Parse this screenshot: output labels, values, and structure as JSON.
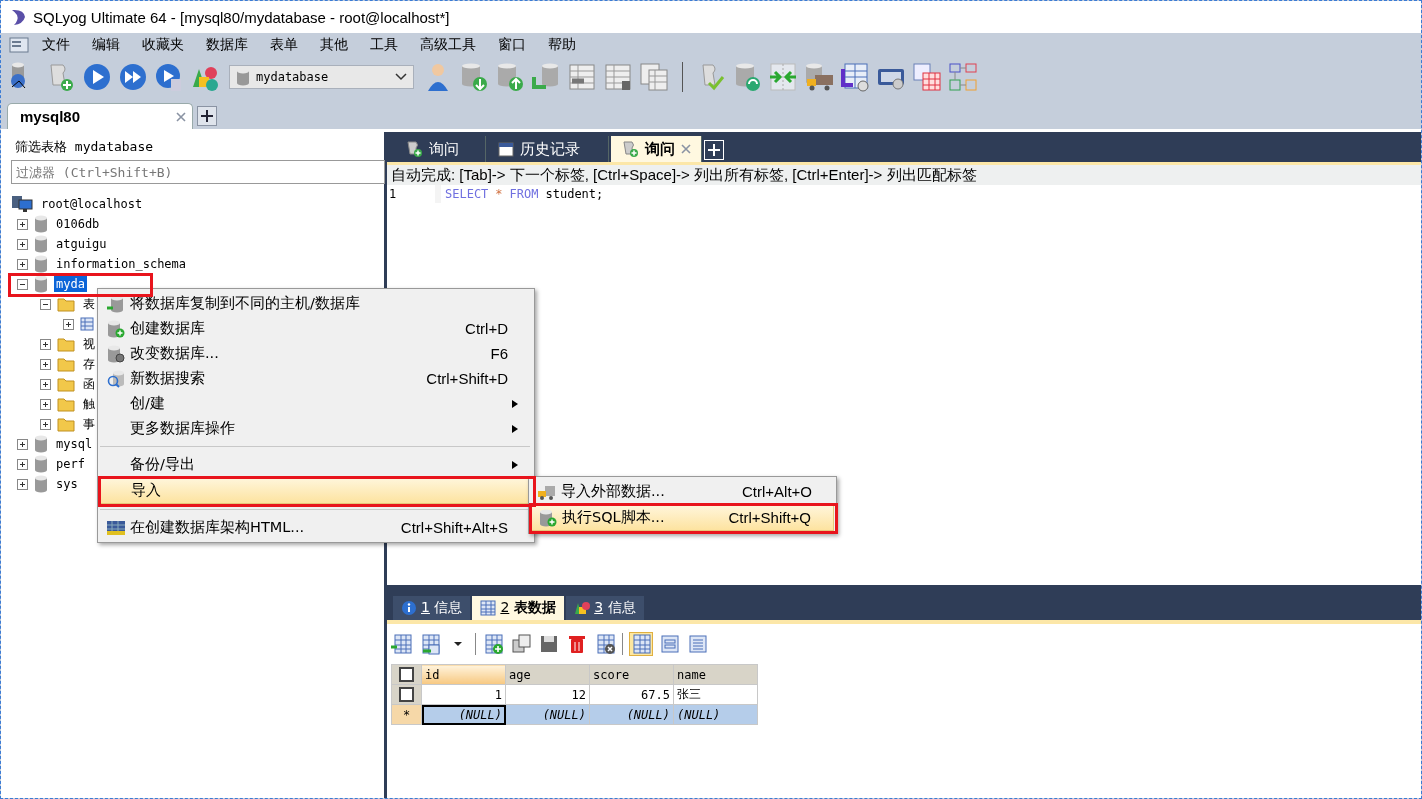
{
  "window": {
    "title": "SQLyog Ultimate 64 - [mysql80/mydatabase - root@localhost*]"
  },
  "menu": [
    "文件",
    "编辑",
    "收藏夹",
    "数据库",
    "表单",
    "其他",
    "工具",
    "高级工具",
    "窗口",
    "帮助"
  ],
  "toolbar": {
    "database_select": "mydatabase"
  },
  "connection_tabs": [
    {
      "label": "mysql80",
      "selected": true
    }
  ],
  "filter": {
    "title": "筛选表格 mydatabase",
    "placeholder": "过滤器 (Ctrl+Shift+B)"
  },
  "tree": {
    "root": "root@localhost",
    "children": [
      {
        "label": "0106db",
        "expanded": false,
        "selected": false,
        "highlighted": false
      },
      {
        "label": "atguigu",
        "expanded": false,
        "selected": false,
        "highlighted": false
      },
      {
        "label": "information_schema",
        "expanded": false,
        "selected": false,
        "highlighted": false
      },
      {
        "label": "myda",
        "expanded": true,
        "selected": true,
        "highlighted": true,
        "children": [
          {
            "label": "表",
            "kind": "folder",
            "expanded": true,
            "children": [
              {
                "kind": "table",
                "expanded": false
              }
            ]
          },
          {
            "label": "视",
            "kind": "folder",
            "expanded": false
          },
          {
            "label": "存",
            "kind": "folder",
            "expanded": false
          },
          {
            "label": "函",
            "kind": "folder",
            "expanded": false
          },
          {
            "label": "触",
            "kind": "folder",
            "expanded": false
          },
          {
            "label": "事",
            "kind": "folder",
            "expanded": false
          }
        ]
      },
      {
        "label": "mysql",
        "expanded": false,
        "selected": false,
        "highlighted": false
      },
      {
        "label": "perf",
        "expanded": false,
        "selected": false,
        "highlighted": false
      },
      {
        "label": "sys",
        "expanded": false,
        "selected": false,
        "highlighted": false
      }
    ]
  },
  "query_tabs": [
    {
      "label": "询问",
      "kind": "query",
      "selected": false,
      "closable": false
    },
    {
      "label": "历史记录",
      "kind": "history",
      "selected": false,
      "closable": false
    },
    {
      "label": "询问",
      "kind": "query",
      "selected": true,
      "closable": true
    }
  ],
  "autocomplete_hint": "自动完成: [Tab]-> 下一个标签, [Ctrl+Space]-> 列出所有标签, [Ctrl+Enter]-> 列出匹配标签",
  "editor": {
    "lines": [
      {
        "number": "1",
        "tokens": [
          {
            "text": "SELECT",
            "kind": "keyword"
          },
          {
            "text": "*",
            "kind": "operator"
          },
          {
            "text": "FROM",
            "kind": "keyword"
          },
          {
            "text": "student;",
            "kind": "plain"
          }
        ]
      }
    ]
  },
  "result_tabs": [
    {
      "number": "1",
      "label": "信息",
      "kind": "info",
      "selected": false
    },
    {
      "number": "2",
      "label": "表数据",
      "kind": "table",
      "selected": true
    },
    {
      "number": "3",
      "label": "信息",
      "kind": "shapes",
      "selected": false
    }
  ],
  "grid": {
    "select_all": {
      "checked": false
    },
    "columns": [
      {
        "label": "id",
        "selected": true
      },
      {
        "label": "age",
        "selected": false
      },
      {
        "label": "score",
        "selected": false
      },
      {
        "label": "name",
        "selected": false
      }
    ],
    "rows": [
      {
        "kind": "data",
        "checked": false,
        "cells": [
          "1",
          "12",
          "67.5",
          "张三"
        ]
      },
      {
        "kind": "new",
        "marker": "*",
        "cells": [
          "(NULL)",
          "(NULL)",
          "(NULL)",
          "(NULL)"
        ]
      }
    ]
  },
  "context_menu": {
    "items": [
      {
        "kind": "copy",
        "label": "将数据库复制到不同的主机/数据库",
        "selected": false,
        "highlighted": false
      },
      {
        "kind": "create",
        "label": "创建数据库",
        "shortcut": "Ctrl+D",
        "selected": false,
        "highlighted": false
      },
      {
        "kind": "alter",
        "label": "改变数据库...",
        "shortcut": "F6",
        "selected": false,
        "highlighted": false
      },
      {
        "kind": "search",
        "label": "新数据搜索",
        "shortcut": "Ctrl+Shift+D",
        "selected": false,
        "highlighted": false
      },
      {
        "kind": "submenu",
        "label": "创/建",
        "selected": false,
        "highlighted": false
      },
      {
        "kind": "submenu",
        "label": "更多数据库操作",
        "selected": false,
        "highlighted": false
      },
      {
        "kind": "separator"
      },
      {
        "kind": "submenu",
        "label": "备份/导出",
        "selected": false,
        "highlighted": false
      },
      {
        "kind": "plain",
        "label": "导入",
        "selected": true,
        "highlighted": true
      },
      {
        "kind": "separator"
      },
      {
        "kind": "html",
        "label": "在创建数据库架构HTML...",
        "shortcut": "Ctrl+Shift+Alt+S",
        "selected": false,
        "highlighted": false
      }
    ]
  },
  "submenu": {
    "items": [
      {
        "kind": "import",
        "label": "导入外部数据...",
        "shortcut": "Ctrl+Alt+O",
        "selected": false,
        "highlighted": false
      },
      {
        "kind": "create",
        "label": "执行SQL脚本...",
        "shortcut": "Ctrl+Shift+Q",
        "selected": true,
        "highlighted": true
      }
    ]
  }
}
